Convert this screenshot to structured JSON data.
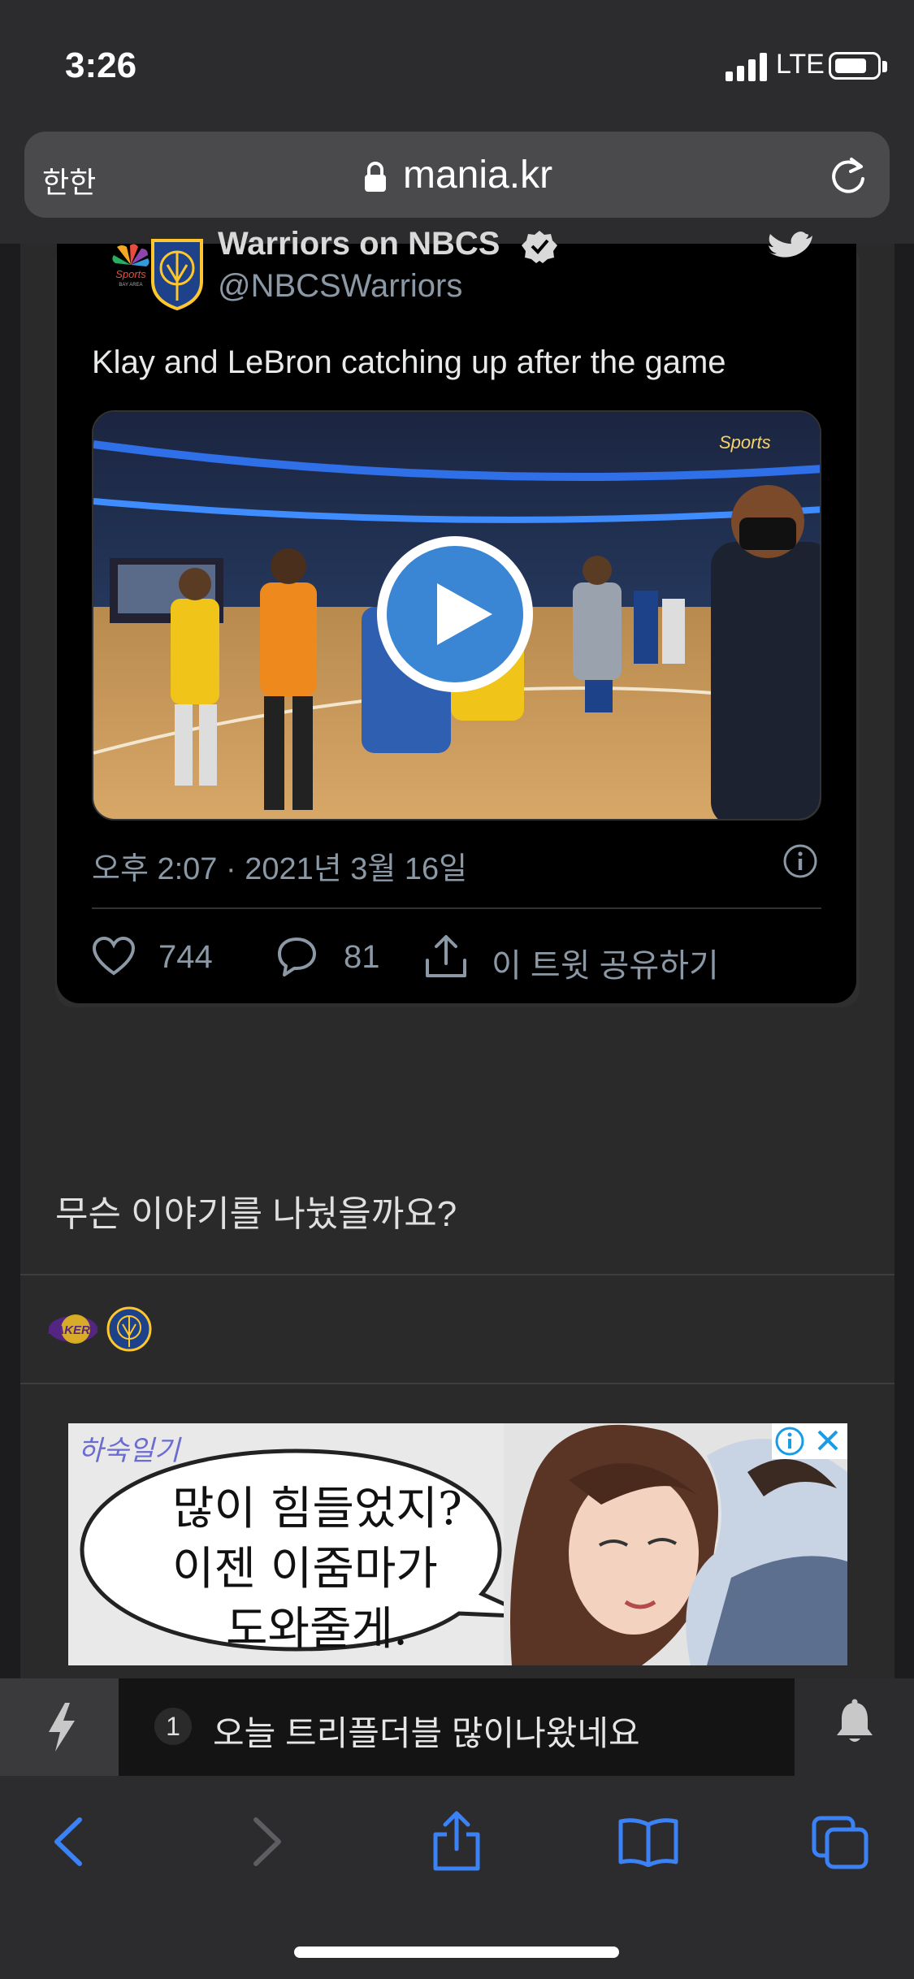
{
  "status_bar": {
    "time": "3:26",
    "network": "LTE"
  },
  "browser": {
    "aa_label": "한한",
    "url": "mania.kr"
  },
  "tweet": {
    "author_name": "Warriors on NBCS",
    "handle": "@NBCSWarriors",
    "text": "Klay and LeBron catching up after the game",
    "timestamp": "오후 2:07 · 2021년 3월 16일",
    "likes": "744",
    "replies": "81",
    "share_label": "이 트윗 공유하기",
    "video_watermark": "Sports"
  },
  "post": {
    "question": "무슨 이야기를 나눴을까요?"
  },
  "ad": {
    "brand": "하숙일기",
    "lines": [
      "많이 힘들었지?",
      "이젠 이줌마가",
      "도와줄게."
    ]
  },
  "notification": {
    "count": "1",
    "text": "오늘 트리플더블 많이나왔네요"
  },
  "icons": {
    "lock": "lock-icon",
    "reload": "reload-icon",
    "play": "play-icon",
    "like": "heart-icon",
    "reply": "comment-icon",
    "share": "share-icon",
    "info": "info-icon",
    "bell": "bell-icon",
    "bolt": "bolt-icon"
  },
  "colors": {
    "accent": "#3b82f6",
    "play_button": "#3a86d4"
  }
}
